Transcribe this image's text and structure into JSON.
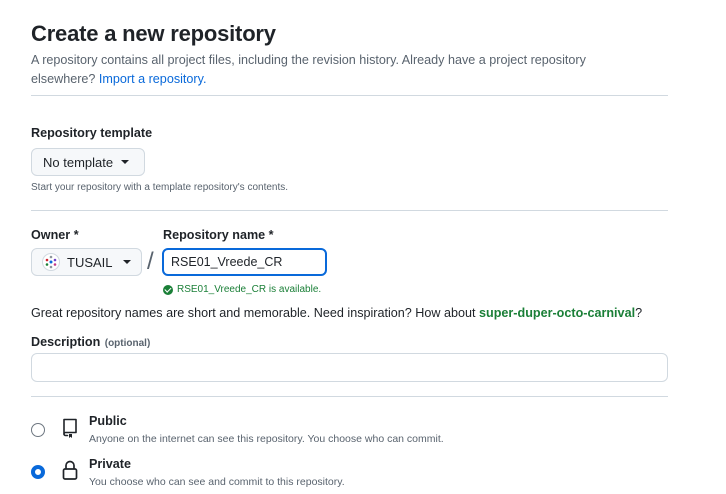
{
  "header": {
    "title": "Create a new repository",
    "intro_text": "A repository contains all project files, including the revision history. Already have a project repository elsewhere?",
    "import_link": "Import a repository."
  },
  "template": {
    "label": "Repository template",
    "button_label": "No template",
    "note": "Start your repository with a template repository's contents."
  },
  "owner": {
    "label": "Owner *",
    "value": "TUSAIL",
    "separator": "/"
  },
  "repo_name": {
    "label": "Repository name *",
    "value": "RSE01_Vreede_CR",
    "availability": "RSE01_Vreede_CR is available."
  },
  "suggestion": {
    "text": "Great repository names are short and memorable. Need inspiration? How about",
    "name": "super-duper-octo-carnival",
    "end": "?"
  },
  "description": {
    "label": "Description",
    "optional": "(optional)",
    "value": ""
  },
  "visibility": {
    "public": {
      "title": "Public",
      "desc": "Anyone on the internet can see this repository. You choose who can commit.",
      "checked": false
    },
    "private": {
      "title": "Private",
      "desc": "You choose who can see and commit to this repository.",
      "checked": true
    }
  },
  "colors": {
    "accent": "#0969da",
    "success": "#1a7f37",
    "border": "#d1d9e0",
    "muted": "#59636e"
  }
}
